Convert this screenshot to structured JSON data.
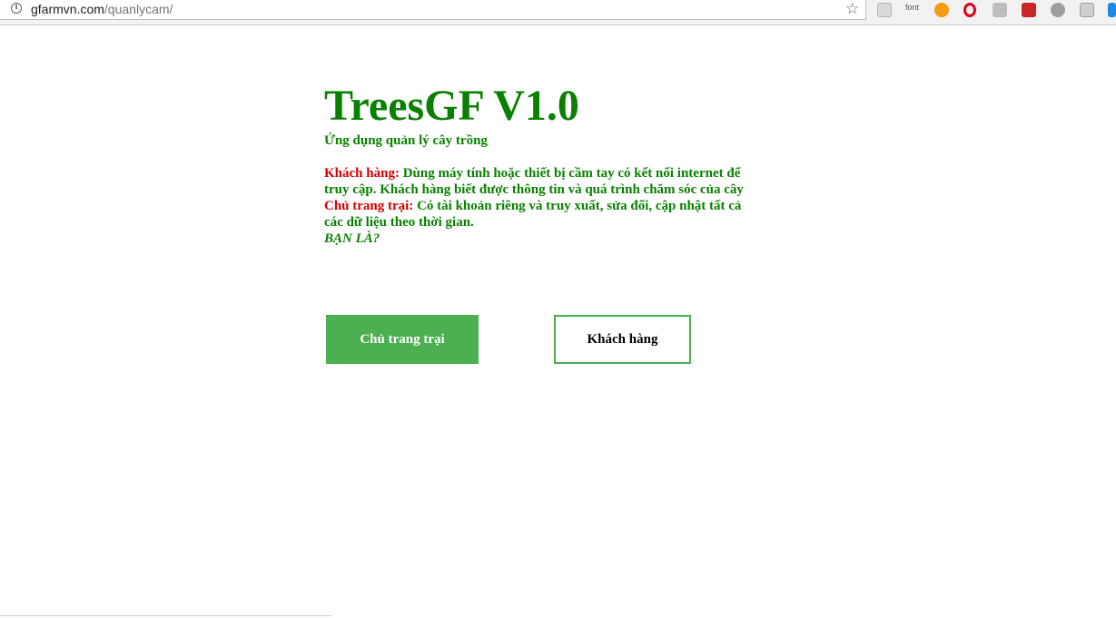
{
  "browser": {
    "url_domain": "gfarmvn.com",
    "url_path": "/quanlycam/",
    "extensions": [
      "image-extension-icon",
      "font-extension-icon",
      "orange-extension-icon",
      "opera-icon",
      "drive-icon",
      "red-book-icon",
      "globe-icon",
      "settings-gear-icon",
      "blue-partial-icon"
    ],
    "font_ext_label": "font"
  },
  "page": {
    "title": "TreesGF V1.0",
    "subtitle": "Ứng dụng quản lý cây trồng",
    "customer_label": "Khách hàng:",
    "customer_desc": " Dùng máy tính hoặc thiết bị cầm tay có kết nối internet để truy cập. Khách hàng biết được thông tin và quá trình chăm sóc của cây",
    "owner_label": "Chủ trang trại:",
    "owner_desc": " Có tài khoản riêng và truy xuất, sửa đổi, cập nhật tất cả các dữ liệu theo thời gian.",
    "question": "BẠN LÀ?"
  },
  "buttons": {
    "owner": "Chủ trang trại",
    "customer": "Khách hàng"
  },
  "colors": {
    "title_green": "#0a8000",
    "role_red": "#d10000",
    "button_green": "#4caf50"
  }
}
